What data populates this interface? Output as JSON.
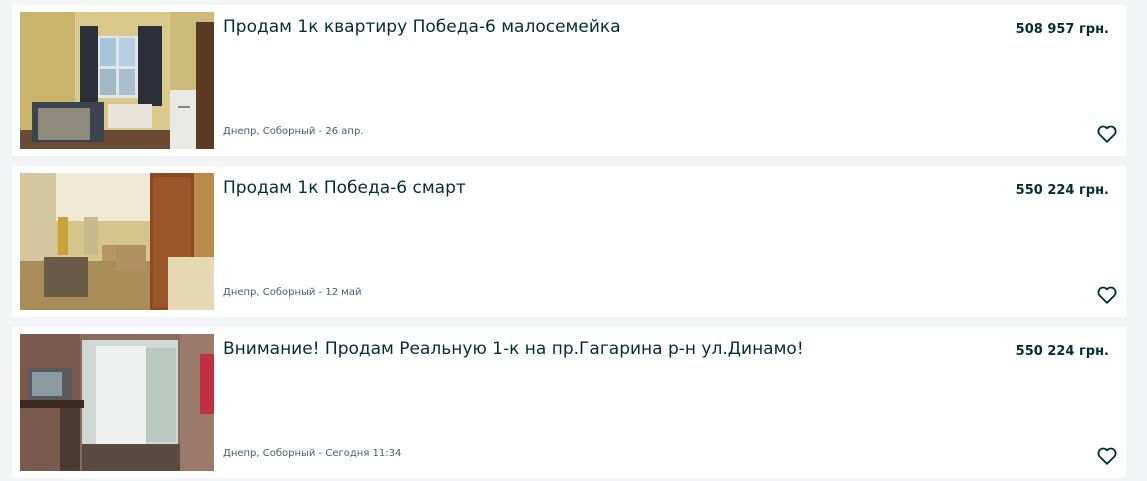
{
  "listings": [
    {
      "title": "Продам 1к квартиру Победа-6 малосемейка",
      "price": "508 957 грн.",
      "location": "Днепр, Соборный",
      "date": "26 апр.",
      "meta": "Днепр, Соборный - 26 апр.",
      "favorite_icon": "heart-outline-icon",
      "photo": "room-with-window-sofa-photo"
    },
    {
      "title": "Продам 1к Победа-6 смарт",
      "price": "550 224 грн.",
      "location": "Днепр, Соборный",
      "date": "12 май",
      "meta": "Днепр, Соборный - 12 май",
      "favorite_icon": "heart-outline-icon",
      "photo": "room-with-wardrobe-armchairs-photo"
    },
    {
      "title": "Внимание! Продам Реальную 1-к на пр.Гагарина р-н ул.Динамо!",
      "price": "550 224 грн.",
      "location": "Днепр, Соборный",
      "date": "Сегодня 11:34",
      "meta": "Днепр, Соборный - Сегодня 11:34",
      "favorite_icon": "heart-outline-icon",
      "photo": "room-with-tv-curtains-photo"
    }
  ],
  "colors": {
    "page_background": "#f2f4f5",
    "card_background": "#ffffff",
    "title_text": "#002f34",
    "meta_text": "#406367"
  }
}
